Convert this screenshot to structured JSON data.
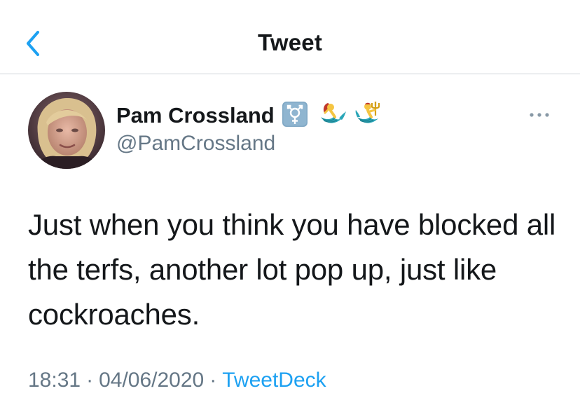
{
  "header": {
    "title": "Tweet",
    "back_icon": "chevron-left-icon"
  },
  "tweet": {
    "display_name": "Pam Crossland",
    "handle": "@PamCrossland",
    "name_icons": [
      "transgender-symbol-icon",
      "mermaid-icon",
      "merman-icon"
    ],
    "text": "Just when you think you have blocked all the terfs, another lot pop up, just like cockroaches.",
    "time": "18:31",
    "separator": "·",
    "date": "04/06/2020",
    "source": "TweetDeck",
    "more_icon": "more-horizontal-icon"
  },
  "colors": {
    "accent": "#1da1f2",
    "text_primary": "#14171a",
    "text_secondary": "#657786",
    "divider": "#cfd5da"
  }
}
